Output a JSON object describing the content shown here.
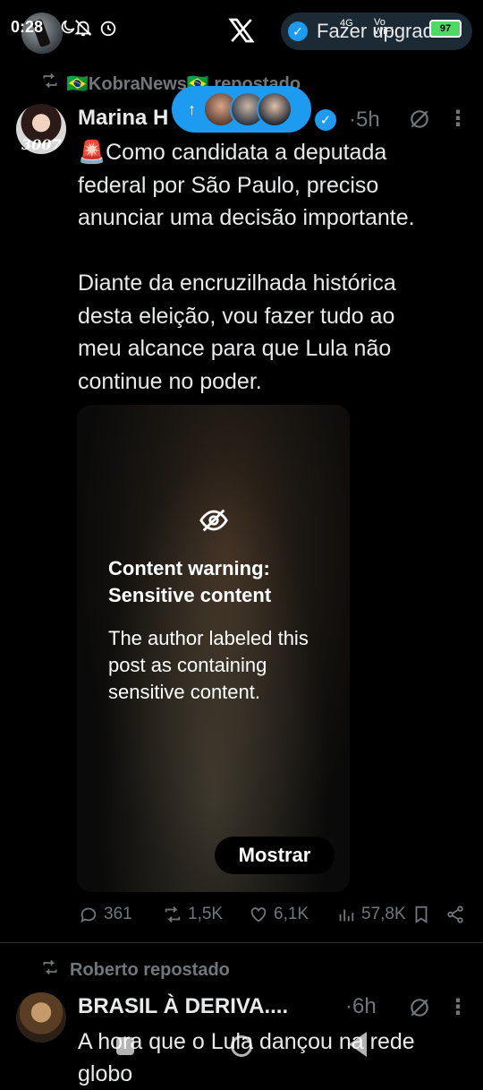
{
  "status_bar": {
    "time": "0:28",
    "network": "4G",
    "volte": "Vo WiFi",
    "battery": "97"
  },
  "header": {
    "upgrade_label": "Fazer upgrade"
  },
  "new_posts_pill": {
    "icon": "arrow-up-icon"
  },
  "post1": {
    "repost_by": "🇧🇷KobraNews🇧🇷 repostado",
    "author": "Marina H",
    "avatar_tag": "3007",
    "time": "·5h",
    "text": "🚨Como candidata a deputada\nfederal por São Paulo, preciso\nanunciar uma decisão importante.\n\nDiante da encruzilhada histórica\ndesta eleição, vou fazer tudo ao\nmeu alcance para que Lula não\ncontinue no poder.",
    "media": {
      "warning_title": "Content warning: Sensitive content",
      "warning_body": "The author labeled this post as containing sensitive content.",
      "show_button": "Mostrar"
    },
    "stats": {
      "replies": "361",
      "reposts": "1,5K",
      "likes": "6,1K",
      "views": "57,8K"
    }
  },
  "post2": {
    "repost_by": "Roberto repostado",
    "author": "BRASIL À DERIVA....",
    "time": "·6h",
    "text": "A hora que o Lula dançou na rede globo"
  },
  "colors": {
    "background": "#000000",
    "accent": "#1d9bf0",
    "muted": "#71767b",
    "text": "#e7e9ea"
  }
}
